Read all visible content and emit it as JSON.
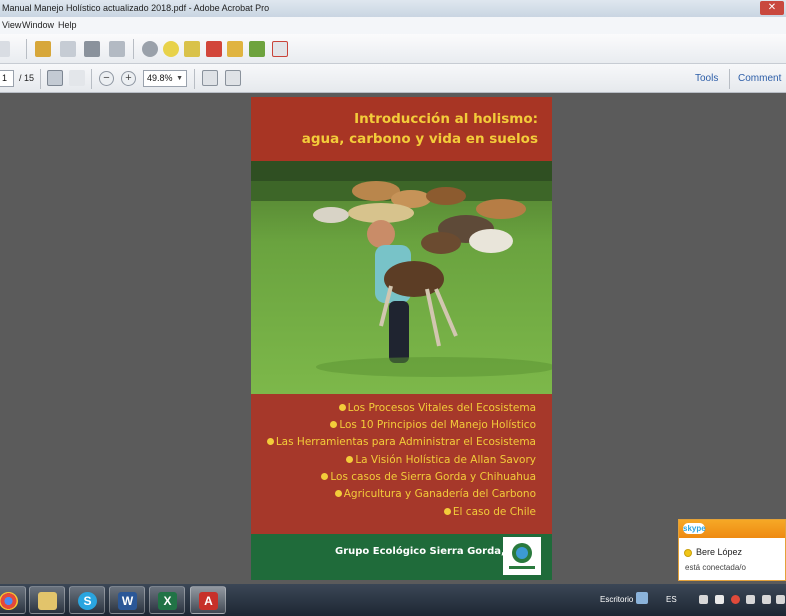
{
  "window": {
    "title": "Manual Manejo Holístico actualizado 2018.pdf - Adobe Acrobat Pro"
  },
  "menu": {
    "items": [
      "View",
      "Window",
      "Help"
    ]
  },
  "toolbar": {
    "page_number": "1",
    "page_total": "/ 15",
    "zoom": "49.8%",
    "tools_label": "Tools",
    "comment_label": "Comment"
  },
  "document": {
    "title_line1": "Introducción al holismo:",
    "title_line2": "agua, carbono y vida en suelos",
    "bullets": [
      "Los Procesos Vitales del Ecosistema",
      "Los 10 Principios del Manejo Holístico",
      "Las Herramientas para Administrar el Ecosistema",
      "La Visión Holística de Allan Savory",
      "Los casos de Sierra Gorda y Chihuahua",
      "Agricultura y Ganadería del Carbono",
      "El caso de Chile"
    ],
    "footer": "Grupo Ecológico Sierra Gorda, IAP"
  },
  "skype": {
    "brand": "skype",
    "contact_name": "Bere López",
    "status": "está conectada/o"
  },
  "taskbar": {
    "desktop_label": "Escritorio",
    "language": "ES",
    "apps": [
      "chrome",
      "file-explorer",
      "skype",
      "word",
      "excel",
      "acrobat"
    ]
  },
  "colors": {
    "title_yellow": "#f3cc3a",
    "header_red": "#a83524",
    "footer_green": "#1f6b3a",
    "skype_orange": "#f19a1c"
  }
}
